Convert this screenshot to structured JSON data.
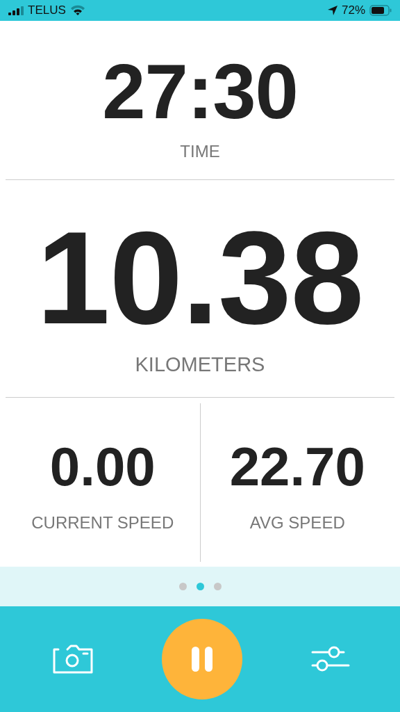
{
  "status_bar": {
    "carrier": "TELUS",
    "battery": "72%"
  },
  "stats": [
    {
      "kind": "time",
      "value": "27:30",
      "label": "TIME"
    },
    {
      "kind": "distance",
      "value": "10.38",
      "label": "KILOMETERS"
    }
  ],
  "speeds": [
    {
      "value": "0.00",
      "label": "CURRENT SPEED"
    },
    {
      "value": "22.70",
      "label": "AVG SPEED"
    }
  ],
  "pages": [
    {
      "selected": false
    },
    {
      "selected": true
    },
    {
      "selected": false
    }
  ],
  "toolbar": {
    "paused": false
  }
}
